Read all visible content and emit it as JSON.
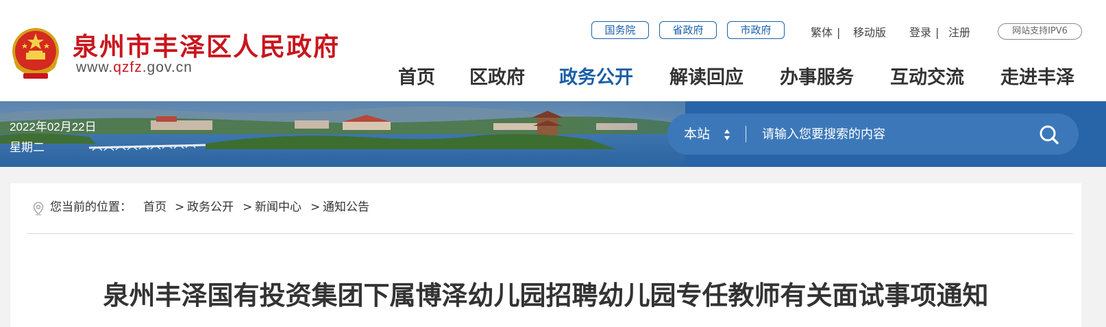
{
  "header": {
    "site_title": "泉州市丰泽区人民政府",
    "site_url_prefix": "www.",
    "site_url_mid": "qzfz",
    "site_url_suffix": ".gov.cn",
    "gov_links": [
      "国务院",
      "省政府",
      "市政府"
    ],
    "traditional": "繁体",
    "mobile": "移动版",
    "login": "登录",
    "register": "注册",
    "ipv6": "网站支持IPV6",
    "nav": [
      "首页",
      "区政府",
      "政务公开",
      "解读回应",
      "办事服务",
      "互动交流",
      "走进丰泽"
    ],
    "active_nav": "政务公开"
  },
  "banner": {
    "date": "2022年02月22日",
    "weekday": "星期二",
    "search": {
      "scope": "本站",
      "placeholder": "请输入您要搜索的内容"
    }
  },
  "breadcrumb": {
    "prefix": "您当前的位置：",
    "items": [
      "首页",
      "政务公开",
      "新闻中心",
      "通知公告"
    ],
    "separator": ">"
  },
  "article": {
    "title": "泉州丰泽国有投资集团下属博泽幼儿园招聘幼儿园专任教师有关面试事项通知"
  },
  "colors": {
    "brand_red": "#c8161d",
    "accent_blue": "#1a5fa8",
    "search_bg": "#3c78b9"
  }
}
